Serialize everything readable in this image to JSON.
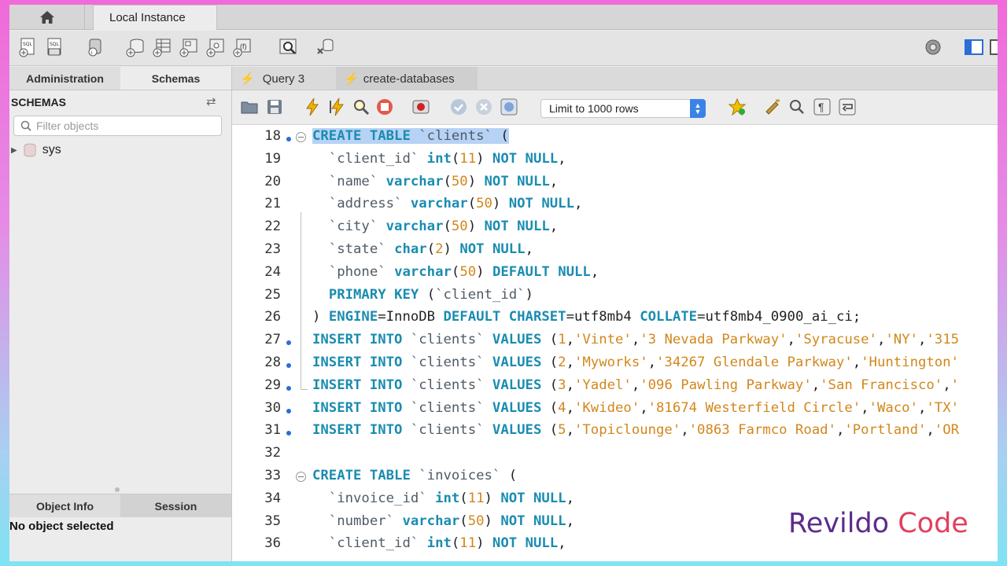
{
  "app": {
    "connection_tab": "Local Instance"
  },
  "sidebar": {
    "tabs": [
      "Administration",
      "Schemas"
    ],
    "header": "SCHEMAS",
    "filter_placeholder": "Filter objects",
    "schemas": [
      "sys"
    ],
    "info_tabs": [
      "Object Info",
      "Session"
    ],
    "info_text": "No object selected"
  },
  "query_tabs": [
    "Query 3",
    "create-databases"
  ],
  "toolbar": {
    "limit_rows": "Limit to 1000 rows"
  },
  "editor": {
    "lines": [
      {
        "num": "18",
        "text": "CREATE TABLE `clients` ("
      },
      {
        "num": "19",
        "text": "  `client_id` int(11) NOT NULL,"
      },
      {
        "num": "20",
        "text": "  `name` varchar(50) NOT NULL,"
      },
      {
        "num": "21",
        "text": "  `address` varchar(50) NOT NULL,"
      },
      {
        "num": "22",
        "text": "  `city` varchar(50) NOT NULL,"
      },
      {
        "num": "23",
        "text": "  `state` char(2) NOT NULL,"
      },
      {
        "num": "24",
        "text": "  `phone` varchar(50) DEFAULT NULL,"
      },
      {
        "num": "25",
        "text": "  PRIMARY KEY (`client_id`)"
      },
      {
        "num": "26",
        "text": ") ENGINE=InnoDB DEFAULT CHARSET=utf8mb4 COLLATE=utf8mb4_0900_ai_ci;"
      },
      {
        "num": "27",
        "text": "INSERT INTO `clients` VALUES (1,'Vinte','3 Nevada Parkway','Syracuse','NY','315"
      },
      {
        "num": "28",
        "text": "INSERT INTO `clients` VALUES (2,'Myworks','34267 Glendale Parkway','Huntington'"
      },
      {
        "num": "29",
        "text": "INSERT INTO `clients` VALUES (3,'Yadel','096 Pawling Parkway','San Francisco','"
      },
      {
        "num": "30",
        "text": "INSERT INTO `clients` VALUES (4,'Kwideo','81674 Westerfield Circle','Waco','TX'"
      },
      {
        "num": "31",
        "text": "INSERT INTO `clients` VALUES (5,'Topiclounge','0863 Farmco Road','Portland','OR"
      },
      {
        "num": "32",
        "text": ""
      },
      {
        "num": "33",
        "text": "CREATE TABLE `invoices` ("
      },
      {
        "num": "34",
        "text": "  `invoice_id` int(11) NOT NULL,"
      },
      {
        "num": "35",
        "text": "  `number` varchar(50) NOT NULL,"
      },
      {
        "num": "36",
        "text": "  `client_id` int(11) NOT NULL,"
      }
    ],
    "selected_text": "CREATE TABLE `clients` ("
  },
  "watermark": {
    "part1": "Revildo",
    "part2": "Code"
  },
  "colors": {
    "keyword": "#1a8cb0",
    "string": "#d2871c",
    "selection": "#b6d2f5"
  }
}
